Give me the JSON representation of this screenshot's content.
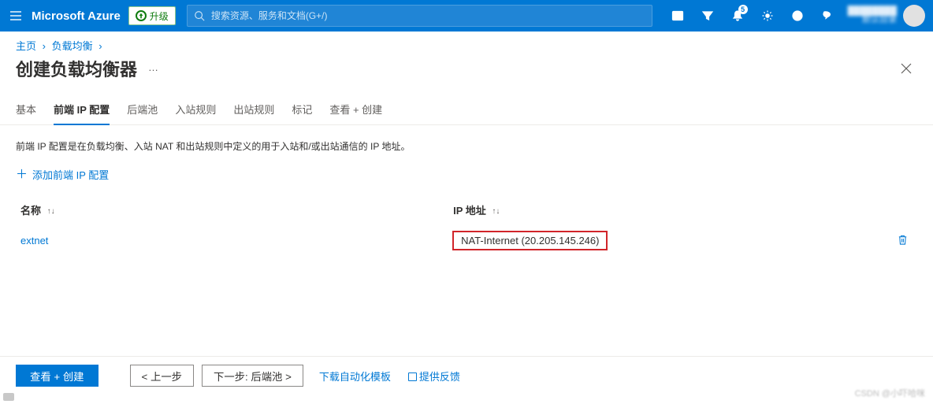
{
  "topbar": {
    "brand": "Microsoft Azure",
    "upgrade_label": "升级",
    "search_placeholder": "搜索资源、服务和文档(G+/)",
    "notification_count": "5"
  },
  "breadcrumb": {
    "items": [
      "主页",
      "负载均衡"
    ]
  },
  "page": {
    "title": "创建负载均衡器",
    "more": "…"
  },
  "tabs": {
    "items": [
      {
        "label": "基本",
        "active": false
      },
      {
        "label": "前端 IP 配置",
        "active": true
      },
      {
        "label": "后端池",
        "active": false
      },
      {
        "label": "入站规则",
        "active": false
      },
      {
        "label": "出站规则",
        "active": false
      },
      {
        "label": "标记",
        "active": false
      },
      {
        "label": "查看 + 创建",
        "active": false
      }
    ]
  },
  "content": {
    "description": "前端 IP 配置是在负载均衡、入站 NAT 和出站规则中定义的用于入站和/或出站通信的 IP 地址。",
    "add_label": "添加前端 IP 配置",
    "columns": {
      "name": "名称",
      "ip": "IP 地址"
    },
    "rows": [
      {
        "name": "extnet",
        "ip": "NAT-Internet (20.205.145.246)"
      }
    ]
  },
  "footer": {
    "review_create": "查看 + 创建",
    "prev": "< 上一步",
    "next": "下一步: 后端池 >",
    "download_template": "下载自动化模板",
    "feedback": "提供反馈"
  },
  "watermark": "CSDN @小吓哈咪"
}
